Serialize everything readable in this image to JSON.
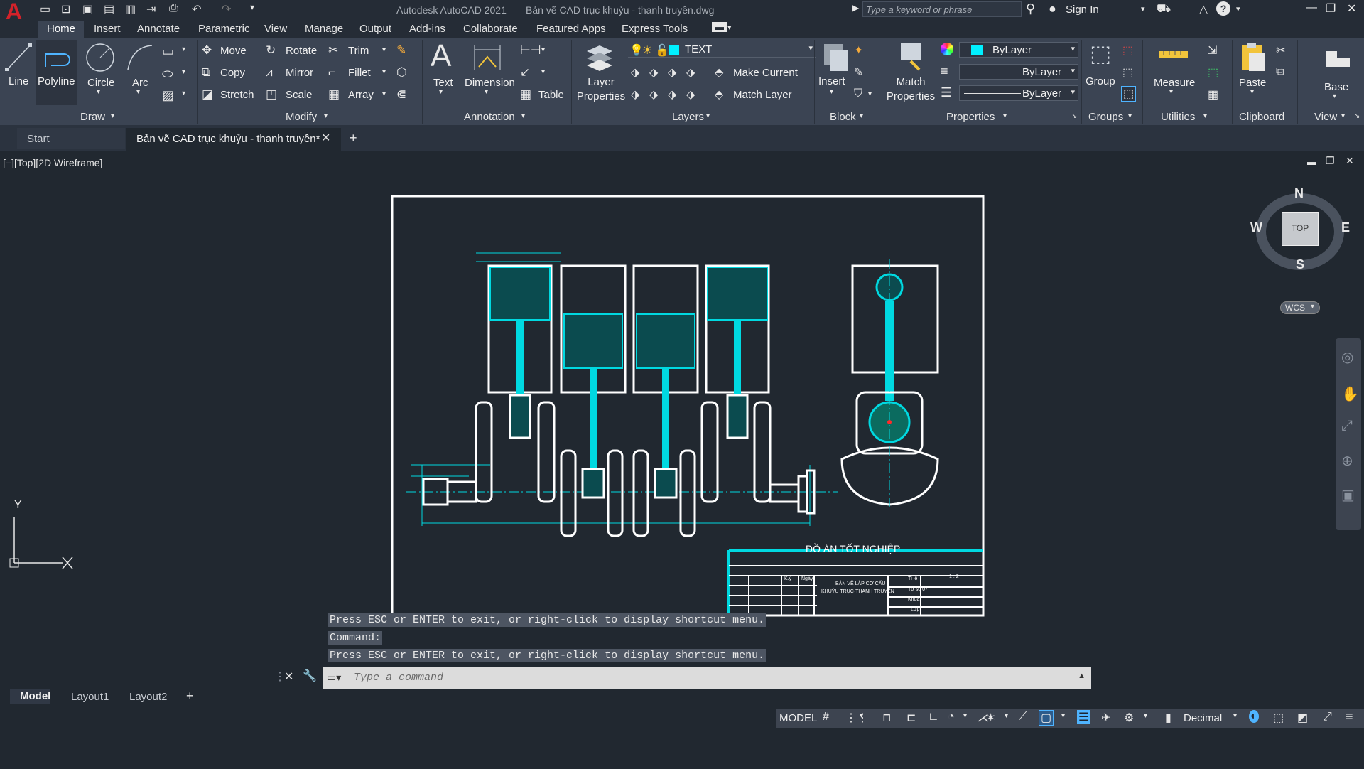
{
  "titlebar": {
    "app_title": "Autodesk AutoCAD 2021",
    "doc_title": "Bản vẽ CAD trục khuỷu - thanh truyền.dwg",
    "search_placeholder": "Type a keyword or phrase",
    "sign_in": "Sign In"
  },
  "ribbon_tabs": [
    "Home",
    "Insert",
    "Annotate",
    "Parametric",
    "View",
    "Manage",
    "Output",
    "Add-ins",
    "Collaborate",
    "Featured Apps",
    "Express Tools"
  ],
  "ribbon": {
    "draw": {
      "title": "Draw",
      "line": "Line",
      "polyline": "Polyline",
      "circle": "Circle",
      "arc": "Arc"
    },
    "modify": {
      "title": "Modify",
      "move": "Move",
      "rotate": "Rotate",
      "trim": "Trim",
      "copy": "Copy",
      "mirror": "Mirror",
      "fillet": "Fillet",
      "stretch": "Stretch",
      "scale": "Scale",
      "array": "Array"
    },
    "annotation": {
      "title": "Annotation",
      "text": "Text",
      "dimension": "Dimension",
      "table": "Table"
    },
    "layers": {
      "title": "Layers",
      "layer_properties": "Layer Properties",
      "current_layer": "TEXT",
      "make_current": "Make Current",
      "match_layer": "Match Layer"
    },
    "block": {
      "title": "Block",
      "insert": "Insert"
    },
    "properties": {
      "title": "Properties",
      "match_properties": "Match Properties",
      "color": "ByLayer",
      "linetype": "ByLayer",
      "lineweight": "ByLayer"
    },
    "groups": {
      "title": "Groups",
      "group": "Group"
    },
    "utilities": {
      "title": "Utilities",
      "measure": "Measure"
    },
    "clipboard": {
      "title": "Clipboard",
      "paste": "Paste"
    },
    "view": {
      "title": "View",
      "base": "Base"
    }
  },
  "doc_tabs": {
    "start": "Start",
    "file": "Bản vẽ CAD trục khuỷu - thanh truyền*"
  },
  "viewport": {
    "label": "[−][Top][2D Wireframe]",
    "viewcube": {
      "face": "TOP",
      "n": "N",
      "s": "S",
      "e": "E",
      "w": "W",
      "ucs": "WCS"
    },
    "axis_y": "Y",
    "title_block": {
      "heading": "ĐỒ ÁN TỐT NGHIỆP",
      "drawing_name_1": "BẢN VẼ LẮP CƠ CẤU",
      "drawing_name_2": "KHUỶU TRỤC-THANH TRUYỀN",
      "scale_label": "Tỉ lệ",
      "scale_value": "1 : 2",
      "sheet_label": "Tờ số 07",
      "faculty_label": "Khoa",
      "class_label": "Lớp",
      "sign_1": "K.ý",
      "sign_2": "Ngày"
    }
  },
  "command": {
    "history": [
      "Press ESC or ENTER to exit, or right-click to display shortcut menu.",
      "Command:",
      "Press ESC or ENTER to exit, or right-click to display shortcut menu."
    ],
    "placeholder": "Type a command"
  },
  "layout_tabs": [
    "Model",
    "Layout1",
    "Layout2"
  ],
  "status": {
    "mode": "MODEL",
    "units": "Decimal"
  },
  "colors": {
    "accent": "#00d9e1",
    "background": "#212830",
    "ribbon": "#3b4453",
    "logo": "#d3222a"
  }
}
